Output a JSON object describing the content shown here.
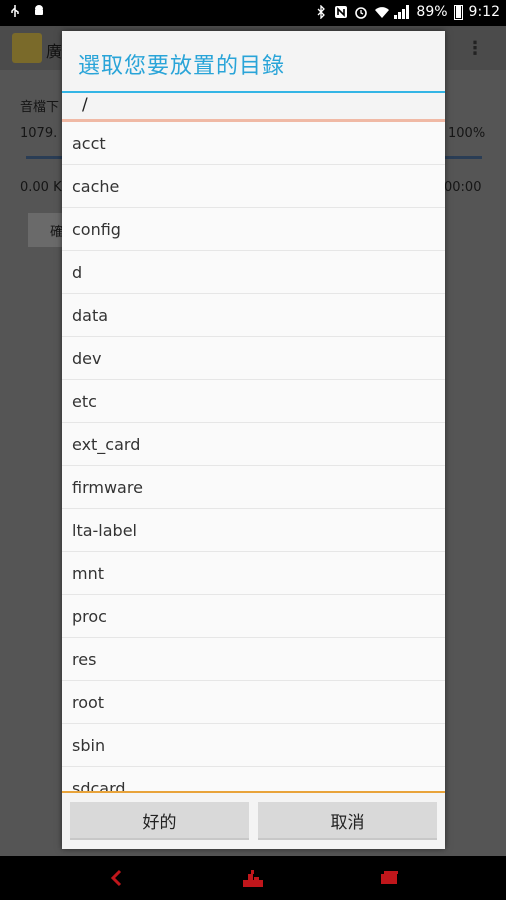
{
  "status_bar": {
    "battery_percent": "89%",
    "time": "9:12",
    "icons": [
      "usb-icon",
      "android-icon",
      "bluetooth-icon",
      "nfc-icon",
      "alarm-icon",
      "wifi-icon",
      "signal-icon",
      "battery-icon"
    ]
  },
  "background_app": {
    "title": "廣",
    "line1": "音檔下",
    "line2_left": "1079.",
    "line2_right": "100%",
    "line3_left": "0.00 K",
    "line3_right": "00:00",
    "button_text": "確"
  },
  "dialog": {
    "title": "選取您要放置的目錄",
    "path": "/",
    "directories": [
      "acct",
      "cache",
      "config",
      "d",
      "data",
      "dev",
      "etc",
      "ext_card",
      "firmware",
      "lta-label",
      "mnt",
      "proc",
      "res",
      "root",
      "sbin",
      "sdcard"
    ],
    "ok_label": "好的",
    "cancel_label": "取消"
  },
  "nav_bar": {
    "colors": {
      "accent": "#c0161b"
    },
    "icons": [
      "back-icon",
      "home-icon",
      "recent-apps-icon"
    ]
  },
  "colors": {
    "title_blue": "#29a4d8",
    "divider_blue": "#33b5e5",
    "list_end_orange": "#e8a33a"
  }
}
